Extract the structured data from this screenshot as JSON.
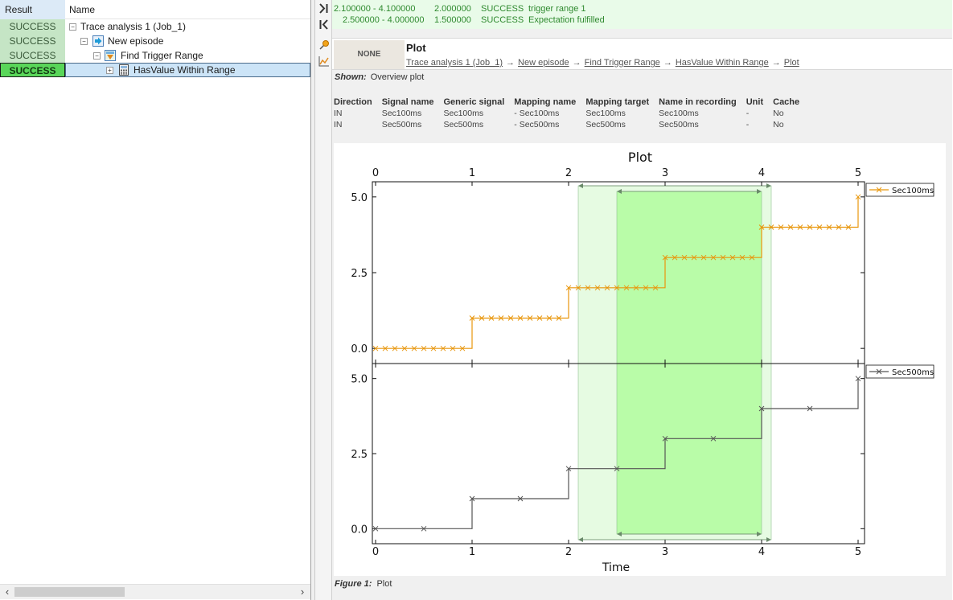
{
  "tree": {
    "header": {
      "result": "Result",
      "name": "Name"
    },
    "rows": [
      {
        "result": "SUCCESS",
        "label": "Trace analysis 1 (Job_1)",
        "icon": "none",
        "expander": "−"
      },
      {
        "result": "SUCCESS",
        "label": "New episode",
        "icon": "episode-icon",
        "expander": "−"
      },
      {
        "result": "SUCCESS",
        "label": "Find Trigger Range",
        "icon": "trigger-icon",
        "expander": "−"
      },
      {
        "result": "SUCCESS",
        "label": "HasValue Within Range",
        "icon": "calculator-icon",
        "expander": "+"
      }
    ]
  },
  "results": [
    {
      "range": "2.100000 - 4.100000",
      "value": "2.000000",
      "status": "SUCCESS",
      "text": "trigger range 1"
    },
    {
      "range": "2.500000 - 4.000000",
      "value": "1.500000",
      "status": "SUCCESS",
      "text": "Expectation fulfilled"
    }
  ],
  "detail": {
    "badge": "NONE",
    "title": "Plot",
    "breadcrumb": [
      "Trace analysis 1 (Job_1)",
      "New episode",
      "Find Trigger Range",
      "HasValue Within Range",
      "Plot"
    ],
    "breadcrumb_sep": "→",
    "shown_label": "Shown:",
    "shown_value": "Overview plot",
    "figure_label": "Figure 1:",
    "figure_value": "Plot"
  },
  "mapping": {
    "columns": [
      "Direction",
      "Signal name",
      "Generic signal",
      "Mapping name",
      "Mapping target",
      "Name in recording",
      "Unit",
      "Cache"
    ],
    "rows": [
      [
        "IN",
        "Sec100ms",
        "Sec100ms",
        "- Sec100ms",
        "Sec100ms",
        "Sec100ms",
        "-",
        "No"
      ],
      [
        "IN",
        "Sec500ms",
        "Sec500ms",
        "- Sec500ms",
        "Sec500ms",
        "Sec500ms",
        "-",
        "No"
      ]
    ]
  },
  "colors": {
    "success_bg": "#c5e5c5",
    "success_selected": "#59d659",
    "series_orange": "#e8960c",
    "series_gray": "#555555",
    "range_light": "#e6fbe2",
    "range_strong": "#b9fca8"
  },
  "chart_data": {
    "type": "line",
    "title": "Plot",
    "xlabel": "Time",
    "xlim": [
      0,
      5
    ],
    "xticks": [
      "0",
      "1",
      "2",
      "3",
      "4",
      "5"
    ],
    "ylim": [
      -0.5,
      5.5
    ],
    "yticks": [
      "0.0",
      "2.5",
      "5.0"
    ],
    "step": true,
    "grid": false,
    "legend": "top-right",
    "ranges": [
      {
        "start": 2.1,
        "end": 4.1,
        "style": "light"
      },
      {
        "start": 2.5,
        "end": 4.0,
        "style": "strong"
      }
    ],
    "series": [
      {
        "name": "Sec100ms",
        "color": "#e8960c",
        "x": [
          0,
          0.1,
          0.2,
          0.3,
          0.4,
          0.5,
          0.6,
          0.7,
          0.8,
          0.9,
          1,
          1.1,
          1.2,
          1.3,
          1.4,
          1.5,
          1.6,
          1.7,
          1.8,
          1.9,
          2,
          2.1,
          2.2,
          2.3,
          2.4,
          2.5,
          2.6,
          2.7,
          2.8,
          2.9,
          3,
          3.1,
          3.2,
          3.3,
          3.4,
          3.5,
          3.6,
          3.7,
          3.8,
          3.9,
          4,
          4.1,
          4.2,
          4.3,
          4.4,
          4.5,
          4.6,
          4.7,
          4.8,
          4.9,
          5
        ],
        "y": [
          0,
          0,
          0,
          0,
          0,
          0,
          0,
          0,
          0,
          0,
          1,
          1,
          1,
          1,
          1,
          1,
          1,
          1,
          1,
          1,
          2,
          2,
          2,
          2,
          2,
          2,
          2,
          2,
          2,
          2,
          3,
          3,
          3,
          3,
          3,
          3,
          3,
          3,
          3,
          3,
          4,
          4,
          4,
          4,
          4,
          4,
          4,
          4,
          4,
          4,
          5
        ]
      },
      {
        "name": "Sec500ms",
        "color": "#555555",
        "x": [
          0,
          0.5,
          1,
          1.5,
          2,
          2.5,
          3,
          3.5,
          4,
          4.5,
          5
        ],
        "y": [
          0,
          0,
          1,
          1,
          2,
          2,
          3,
          3,
          4,
          4,
          5
        ]
      }
    ]
  }
}
